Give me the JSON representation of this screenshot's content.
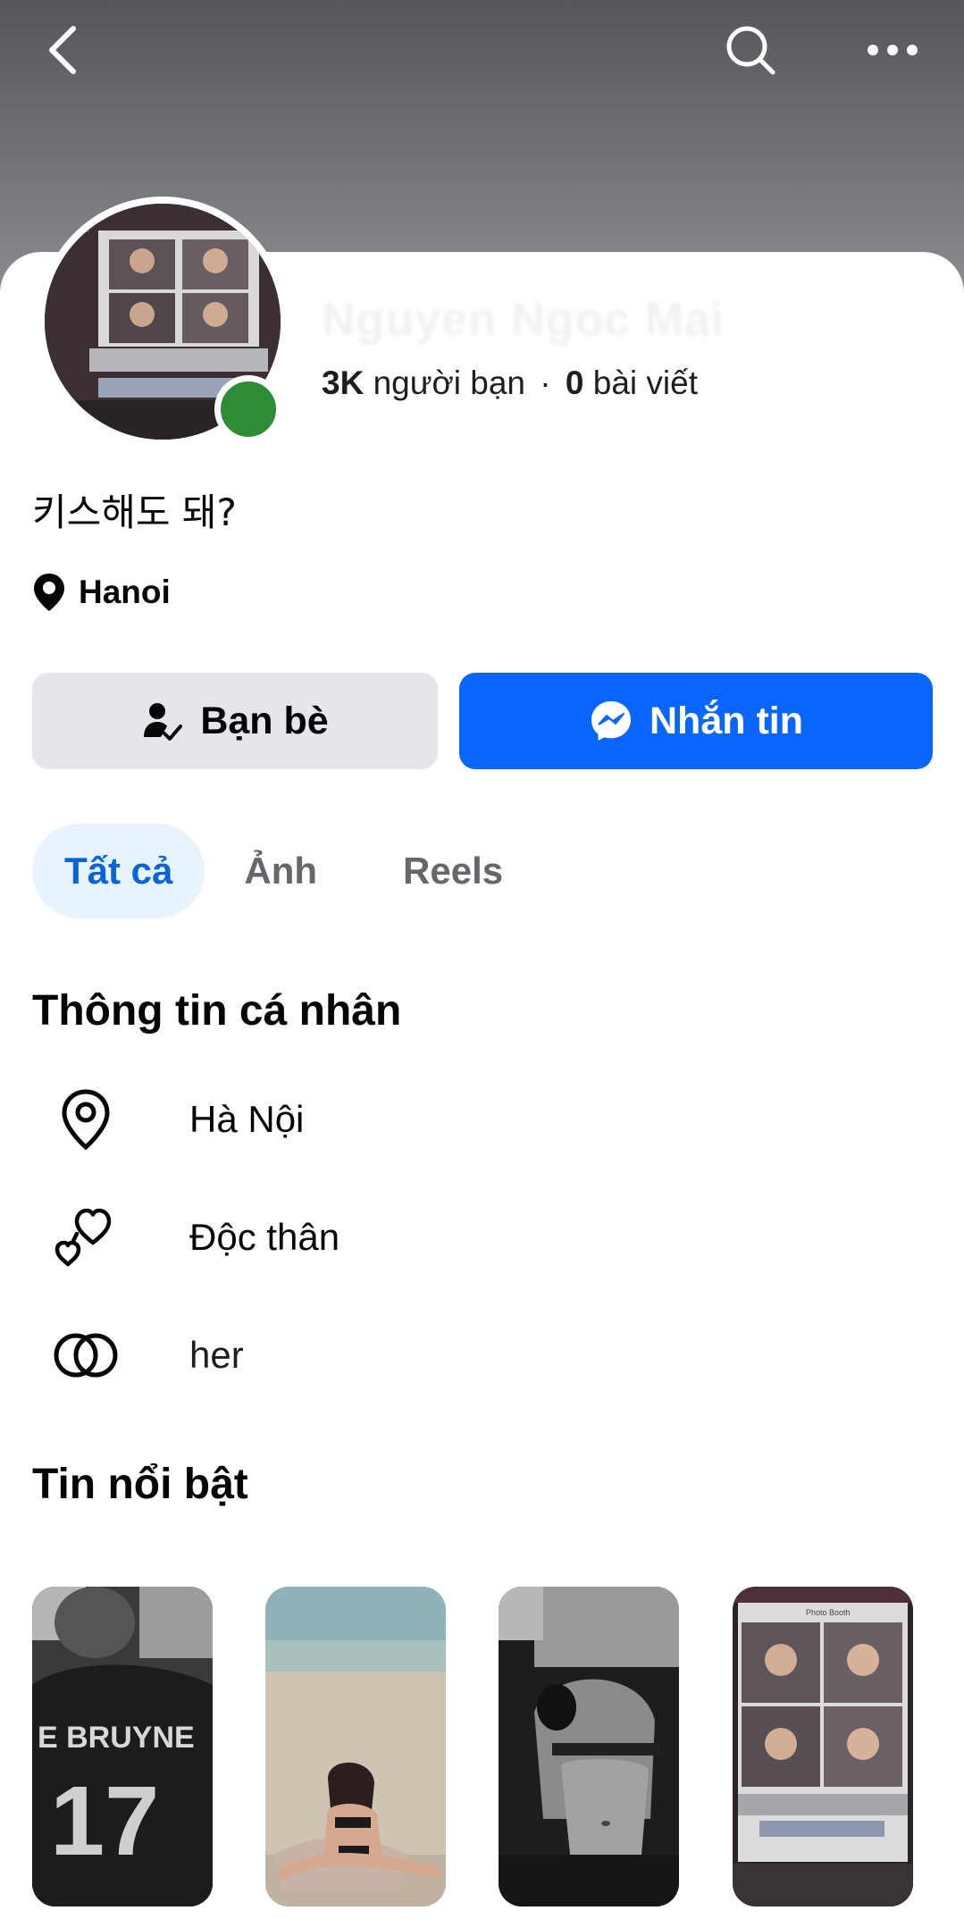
{
  "topbar": {
    "back_icon": "chevron-left-icon",
    "search_icon": "search-icon",
    "more_icon": "more-horizontal-icon"
  },
  "profile": {
    "name": "Nguyen Ngoc Mai",
    "friends_count": "3K",
    "friends_label": "người bạn",
    "separator": "·",
    "posts_count": "0",
    "posts_label": "bài viết",
    "bio": "키스해도 돼?",
    "location": "Hanoi",
    "online_color": "#2e8b36"
  },
  "actions": {
    "friends_label": "Bạn bè",
    "message_label": "Nhắn tin",
    "accent": "#0866ff"
  },
  "tabs": [
    {
      "label": "Tất cả",
      "active": true
    },
    {
      "label": "Ảnh",
      "active": false
    },
    {
      "label": "Reels",
      "active": false
    }
  ],
  "personal_info": {
    "title": "Thông tin cá nhân",
    "items": [
      {
        "icon": "location-pin-icon",
        "text": "Hà Nội"
      },
      {
        "icon": "hearts-icon",
        "text": "Độc thân"
      },
      {
        "icon": "interlocked-rings-icon",
        "text": "her"
      }
    ]
  },
  "highlights": {
    "title": "Tin nổi bật",
    "stories": [
      {
        "name": "story-1",
        "text": "E BRUYNE",
        "number": "17"
      },
      {
        "name": "story-2"
      },
      {
        "name": "story-3"
      },
      {
        "name": "story-4",
        "text": "Photo Booth"
      }
    ]
  }
}
